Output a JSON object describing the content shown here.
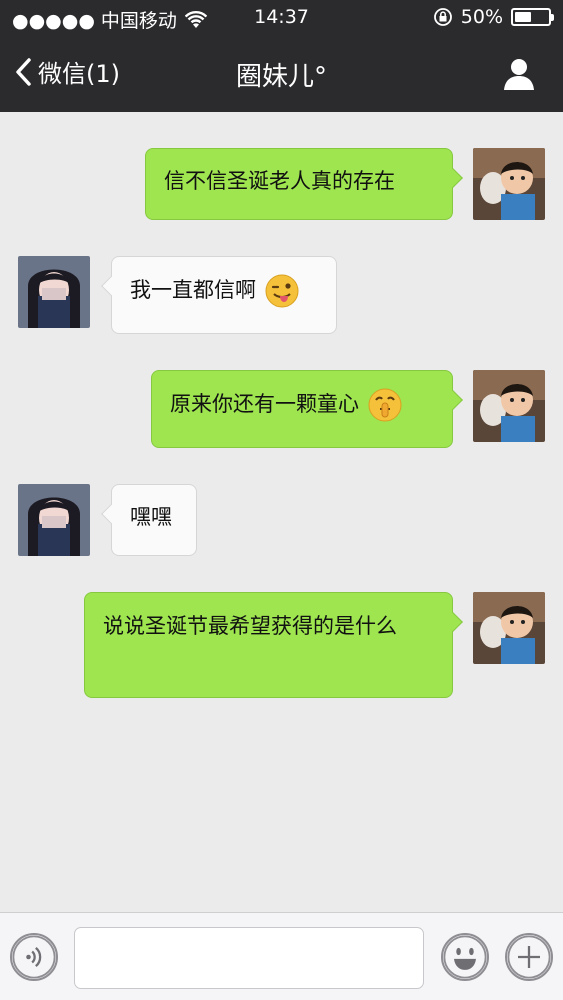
{
  "status_bar": {
    "carrier": "●●●●● 中国移动",
    "time": "14:37",
    "battery_text": "50%",
    "battery_level": 0.5
  },
  "nav": {
    "back_label": "微信(1)",
    "title": "圈妹儿°"
  },
  "messages": [
    {
      "direction": "out",
      "text": "信不信圣诞老人真的存在",
      "emoji": ""
    },
    {
      "direction": "in",
      "text": "我一直都信啊",
      "emoji": "winking-tongue-emoji"
    },
    {
      "direction": "out",
      "text": "原来你还有一颗童心",
      "emoji": "shushing-face-emoji"
    },
    {
      "direction": "in",
      "text": "嘿嘿",
      "emoji": ""
    },
    {
      "direction": "out",
      "text": "说说圣诞节最希望获得的是什么",
      "emoji": ""
    }
  ],
  "input_bar": {
    "message_value": "",
    "voice_icon": "voice-icon",
    "emoji_icon": "emoji-icon",
    "more_icon": "plus-icon"
  },
  "colors": {
    "outgoing_bubble": "#9ee550",
    "incoming_bubble": "#fafafa",
    "nav_background": "#2b2b2e",
    "chat_background": "#ebebeb"
  }
}
